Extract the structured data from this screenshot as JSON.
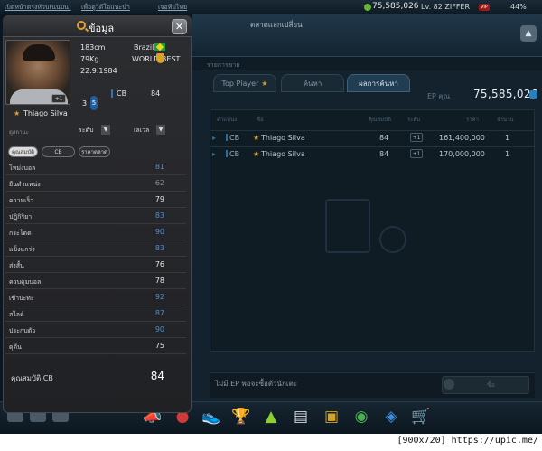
{
  "topbar": {
    "link_1": "เปิดหน้าตรงหัวบ(นนบน)",
    "link_2": "เพื่อดูวิดีโอแนะนำ",
    "link_3": "เจอทีมไทย",
    "coins": "75,585,026",
    "level": "Lv. 82 ZIFFER",
    "vip": "VIP",
    "battery": "44%"
  },
  "market": {
    "title": "ตลาดแลกเปลี่ยน",
    "sub_label": "รายการขาย",
    "tabs": [
      "Top Player",
      "ค้นหา",
      "ผลการค้นหา"
    ],
    "ep_label": "EP คุณ",
    "ep_value": "75,585,026",
    "columns": [
      "ตำแหน่ง",
      "ชื่อ",
      "คุณสมบัติ",
      "ระดับ",
      "ราคา",
      "จำนวน"
    ],
    "rows": [
      {
        "pos": "CB",
        "name": "Thiago Silva",
        "ovr": "84",
        "level": "+1",
        "price": "161,400,000",
        "qty": "1"
      },
      {
        "pos": "CB",
        "name": "Thiago Silva",
        "ovr": "84",
        "level": "+1",
        "price": "170,000,000",
        "qty": "1"
      }
    ],
    "no_ep": "ไม่มี EP พอจะซื้อตัวนักเตะ",
    "buy_label": "ซื้อ"
  },
  "info": {
    "title": "ข้อมูล",
    "close": "✕",
    "name": "Thiago Silva",
    "photo_level": "+1",
    "height": "183cm",
    "weight": "79Kg",
    "dob": "22.9.1984",
    "country": "Brazil",
    "badge": "WORLD BEST",
    "pos_a": "3",
    "pos_b": "5",
    "position": "CB",
    "position_ovr": "84",
    "select_label": "ดูสถานะ",
    "select_a": "ระดับ",
    "select_b": "เลเวล",
    "chips": [
      "คุณสมบัติ",
      "CB",
      "ราคาตลาด"
    ],
    "stats": [
      {
        "name": "โหม่งบอล",
        "value": "81",
        "color": "#4a8fd8"
      },
      {
        "name": "ยืนตำแหน่ง",
        "value": "62",
        "color": "#8c8f94"
      },
      {
        "name": "ความเร็ว",
        "value": "79",
        "color": "#e6e6e6"
      },
      {
        "name": "ปฏิกิริยา",
        "value": "83",
        "color": "#4a8fd8"
      },
      {
        "name": "กระโดด",
        "value": "90",
        "color": "#4a8fd8"
      },
      {
        "name": "แข็งแกร่ง",
        "value": "83",
        "color": "#4a8fd8"
      },
      {
        "name": "ส่งสั้น",
        "value": "76",
        "color": "#e6e6e6"
      },
      {
        "name": "ควบคุมบอล",
        "value": "78",
        "color": "#e6e6e6"
      },
      {
        "name": "เข้าปะทะ",
        "value": "92",
        "color": "#4a8fd8"
      },
      {
        "name": "สไลด์",
        "value": "87",
        "color": "#4a8fd8"
      },
      {
        "name": "ประกบตัว",
        "value": "90",
        "color": "#4a8fd8"
      },
      {
        "name": "ดุดัน",
        "value": "75",
        "color": "#e6e6e6"
      }
    ],
    "ovr_label": "คุณสมบัติ CB",
    "ovr_value": "84"
  },
  "footer": "[900x720] https://upic.me/"
}
